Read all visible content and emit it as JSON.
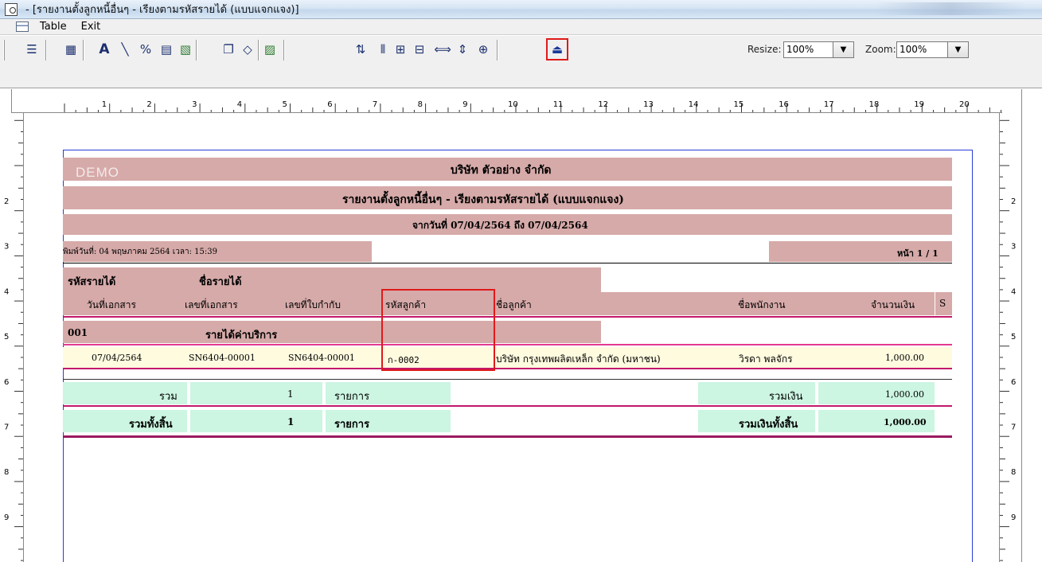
{
  "window": {
    "title": "- [รายงานตั้งลูกหนี้อื่นๆ - เรียงตามรหัสรายได้ (แบบแจกแจง)]"
  },
  "menu": {
    "items": [
      "Table",
      "Exit"
    ]
  },
  "toolbar": {
    "icons": [
      "align-icon",
      "table-icon",
      "text-icon",
      "line-icon",
      "percent-icon",
      "grid-icon",
      "image-icon",
      "copy-icon",
      "eraser-icon",
      "chart-icon",
      "sort-icon",
      "columns-icon",
      "merge-icon",
      "rows-icon",
      "width-icon",
      "height-icon",
      "fit-icon",
      "exit-icon"
    ],
    "resize_label": "Resize:",
    "resize_value": "100%",
    "zoom_label": "Zoom:",
    "zoom_value": "100%",
    "highlight_color": "#e01a1a"
  },
  "ruler": {
    "top_numbers": [
      "1",
      "2",
      "3",
      "4",
      "5",
      "6",
      "7",
      "8",
      "9",
      "10",
      "11",
      "12",
      "13",
      "14",
      "15",
      "16",
      "17",
      "18",
      "19",
      "20"
    ],
    "side_numbers": [
      "2",
      "3",
      "4",
      "5",
      "6",
      "7",
      "8",
      "9"
    ]
  },
  "report": {
    "watermark": "DEMO",
    "company": "บริษัท ตัวอย่าง จำกัด",
    "title": "รายงานตั้งลูกหนี้อื่นๆ - เรียงตามรหัสรายได้ (แบบแจกแจง)",
    "date_range": "จากวันที่ 07/04/2564 ถึง 07/04/2564",
    "printed": "พิมพ์วันที่: 04 พฤษภาคม 2564 เวลา: 15:39",
    "page": "หน้า 1 / 1",
    "columns": {
      "income_code": "รหัสรายได้",
      "income_name": "ชื่อรายได้",
      "doc_date": "วันที่เอกสาร",
      "doc_no": "เลขที่เอกสาร",
      "invoice_no": "เลขที่ใบกำกับ",
      "customer_code": "รหัสลูกค้า",
      "customer_name": "ชื่อลูกค้า",
      "employee": "ชื่อพนักงาน",
      "amount": "จำนวนเงิน",
      "s": "S"
    },
    "group": {
      "code": "001",
      "name": "รายได้ค่าบริการ"
    },
    "rows": [
      {
        "doc_date": "07/04/2564",
        "doc_no": "SN6404-00001",
        "invoice_no": "SN6404-00001",
        "customer_code": "ก-0002",
        "customer_name": "บริษัท กรุงเทพผลิตเหล็ก จำกัด (มหาชน)",
        "employee": "วิรดา  พลจักร",
        "amount": "1,000.00"
      }
    ],
    "subtotal": {
      "label": "รวม",
      "count": "1",
      "unit": "รายการ",
      "sum_label": "รวมเงิน",
      "sum": "1,000.00"
    },
    "grand_total": {
      "label": "รวมทั้งสิ้น",
      "count": "1",
      "unit": "รายการ",
      "sum_label": "รวมเงินทั้งสิ้น",
      "sum": "1,000.00"
    },
    "colors": {
      "header_band": "#d6aaa9",
      "total_band": "#ccf5e2",
      "detail_band": "#fffbdf",
      "rule": "#c2186b",
      "page_border": "#2a3cd8"
    }
  }
}
